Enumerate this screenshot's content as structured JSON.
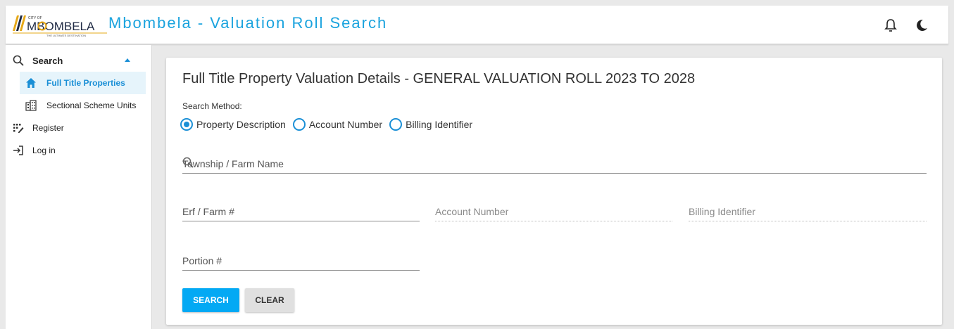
{
  "header": {
    "logo_text": "MBOMBELA",
    "logo_small_top": "CITY OF",
    "logo_tagline": "THE ULTIMATE DESTINATION",
    "title": "Mbombela - Valuation Roll Search",
    "icons": [
      "bell-icon",
      "moon-icon"
    ]
  },
  "sidebar": {
    "items": [
      {
        "label": "Search",
        "icon": "search-icon",
        "expanded": true
      },
      {
        "label": "Full Title Properties",
        "icon": "home-icon",
        "active": true
      },
      {
        "label": "Sectional Scheme Units",
        "icon": "building-icon"
      },
      {
        "label": "Register",
        "icon": "register-icon"
      },
      {
        "label": "Log in",
        "icon": "login-icon"
      }
    ]
  },
  "main": {
    "title": "Full Title Property Valuation Details - GENERAL VALUATION ROLL 2023 TO 2028",
    "search_method_label": "Search Method:",
    "methods": [
      {
        "label": "Property Description",
        "selected": true
      },
      {
        "label": "Account Number",
        "selected": false
      },
      {
        "label": "Billing Identifier",
        "selected": false
      }
    ],
    "fields": {
      "township": "Township / Farm Name",
      "erf": "Erf / Farm #",
      "account": "Account Number",
      "billing": "Billing Identifier",
      "portion": "Portion #"
    },
    "buttons": {
      "search": "SEARCH",
      "clear": "CLEAR"
    }
  },
  "colors": {
    "accent": "#1aa3de",
    "primary_button": "#03a9f4",
    "active_bg": "#e6f4fb",
    "logo_gold": "#e6a817"
  }
}
